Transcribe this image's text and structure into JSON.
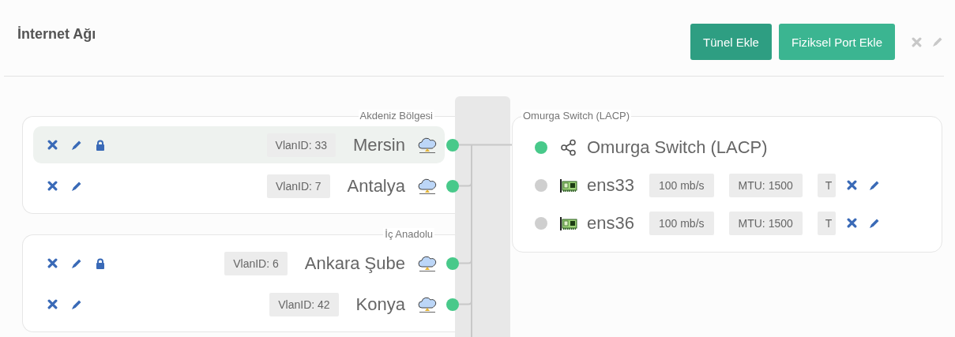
{
  "header": {
    "title": "İnternet Ağı",
    "buttons": [
      {
        "label": "Tünel Ekle",
        "kind": "dark"
      },
      {
        "label": "Fiziksel Port Ekle",
        "kind": "light"
      }
    ]
  },
  "groups": [
    {
      "title": "Akdeniz Bölgesi",
      "networks": [
        {
          "name": "Mersin",
          "vlan": "VlanID: 33",
          "locked": true,
          "selected": true,
          "connected": true
        },
        {
          "name": "Antalya",
          "vlan": "VlanID: 7",
          "locked": false,
          "selected": false,
          "connected": true
        }
      ]
    },
    {
      "title": "İç Anadolu",
      "networks": [
        {
          "name": "Ankara Şube",
          "vlan": "VlanID: 6",
          "locked": true,
          "selected": false,
          "connected": true
        },
        {
          "name": "Konya",
          "vlan": "VlanID: 42",
          "locked": false,
          "selected": false,
          "connected": true
        }
      ]
    }
  ],
  "switch": {
    "group_title": "Omurga Switch (LACP)",
    "name": "Omurga Switch (LACP)",
    "connected": true,
    "ports": [
      {
        "name": "ens33",
        "speed": "100 mb/s",
        "mtu": "MTU: 1500",
        "column_3": "T",
        "connected": false
      },
      {
        "name": "ens36",
        "speed": "100 mb/s",
        "mtu": "MTU: 1500",
        "column_3": "T",
        "connected": false
      }
    ]
  }
}
